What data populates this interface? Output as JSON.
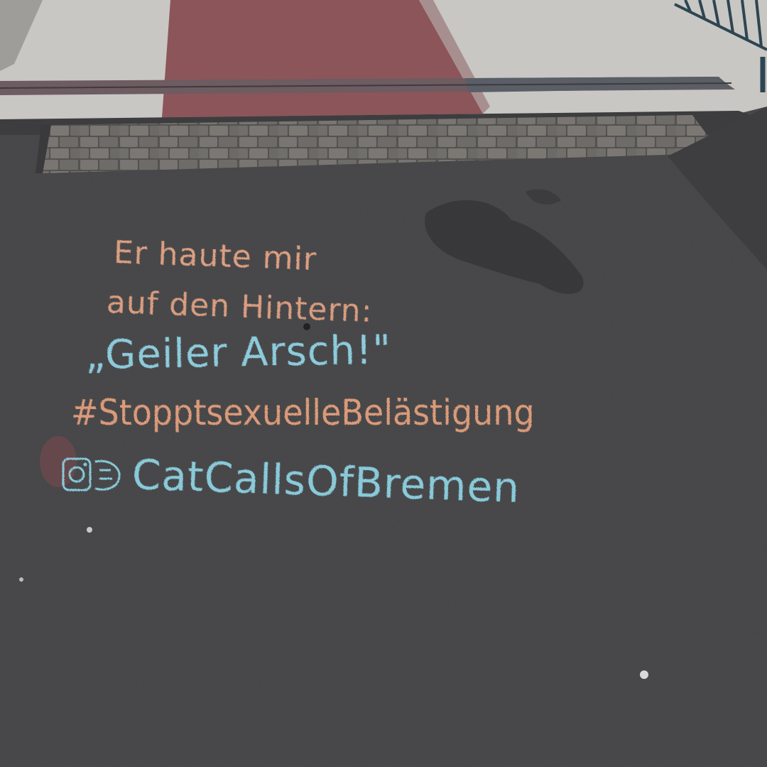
{
  "colors": {
    "asphalt": "#4a4a4c",
    "pavement": "#c7c6c3",
    "bike_lane": "#8a5559",
    "cobble": "#6b6a68",
    "chalk_orange": "#e9a787",
    "chalk_blue": "#8fd6e6",
    "railing": "#2e4552"
  },
  "chalk_message": {
    "line1": "Er haute mir",
    "line2": "auf den Hintern:",
    "line3": "„Geiler Arsch!\"",
    "hashtag": "#StopptsexuelleBelästigung",
    "handle": "CatCallsOfBremen",
    "handle_icon": "instagram-icon"
  }
}
